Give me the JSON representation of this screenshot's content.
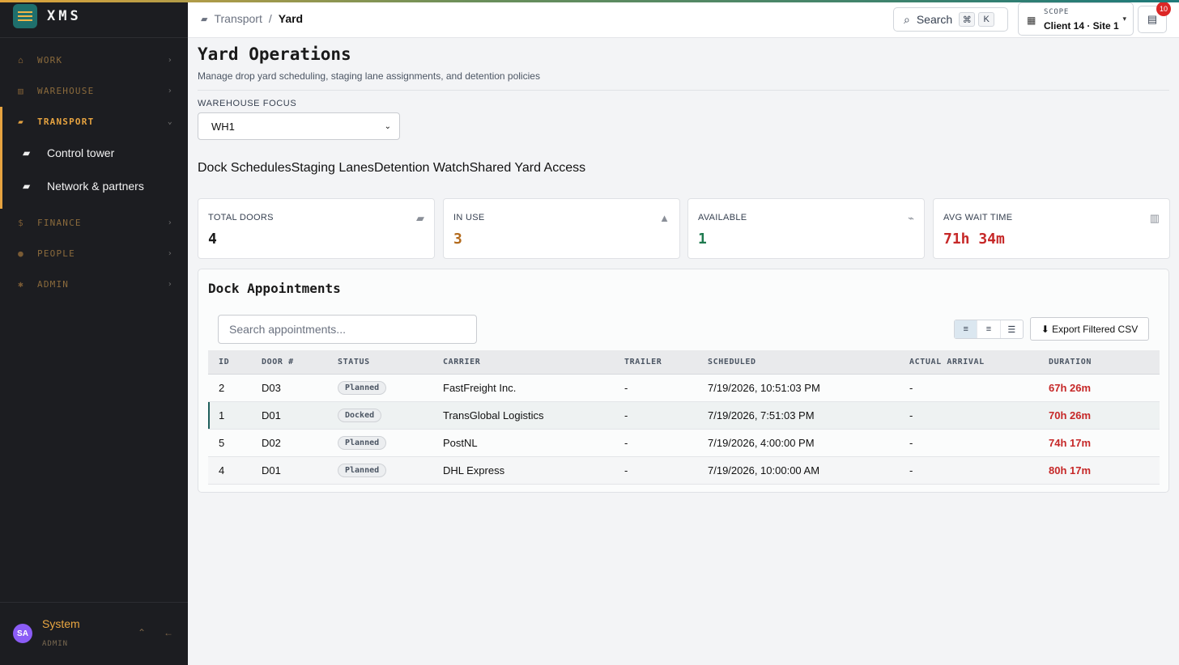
{
  "app": {
    "name": "XMS"
  },
  "colors": {
    "accent": "#e6a340",
    "teal": "#1f6f6c",
    "danger": "#c62828",
    "success": "#1e7a4f",
    "warning": "#b36b1e"
  },
  "sidebar": {
    "items": [
      {
        "label": "WORK",
        "icon": "home-icon"
      },
      {
        "label": "WAREHOUSE",
        "icon": "warehouse-icon"
      },
      {
        "label": "TRANSPORT",
        "icon": "truck-icon",
        "active": true
      },
      {
        "label": "FINANCE",
        "icon": "dollar-icon"
      },
      {
        "label": "PEOPLE",
        "icon": "person-icon"
      },
      {
        "label": "ADMIN",
        "icon": "gear-icon"
      }
    ],
    "sub_items": [
      {
        "label": "Control tower",
        "icon": "truck-icon"
      },
      {
        "label": "Network & partners",
        "icon": "truck-icon"
      }
    ],
    "user": {
      "initials": "SA",
      "name": "System",
      "role": "ADMIN"
    }
  },
  "header": {
    "breadcrumb": {
      "parent": "Transport",
      "sep": "/",
      "current": "Yard"
    },
    "search_label": "Search",
    "kbd_cmd": "⌘",
    "kbd_key": "K",
    "scope_label": "SCOPE",
    "scope_value": "Client 14 · Site 1",
    "notif_count": "10"
  },
  "page": {
    "title": "Yard Operations",
    "subtitle": "Manage drop yard scheduling, staging lane assignments, and detention policies",
    "warehouse_label": "WAREHOUSE FOCUS",
    "warehouse_value": "WH1",
    "tabs": [
      "Dock Schedules",
      "Staging Lanes",
      "Detention Watch",
      "Shared Yard Access"
    ]
  },
  "stats": [
    {
      "label": "TOTAL DOORS",
      "value": "4",
      "icon": "truck-icon",
      "color": "#1a1a1a"
    },
    {
      "label": "IN USE",
      "value": "3",
      "icon": "warning-icon",
      "color": "#b36b1e"
    },
    {
      "label": "AVAILABLE",
      "value": "1",
      "icon": "activity-icon",
      "color": "#1e7a4f"
    },
    {
      "label": "AVG WAIT TIME",
      "value": "71h 34m",
      "icon": "chart-icon",
      "color": "#c62828"
    }
  ],
  "appointments": {
    "title": "Dock Appointments",
    "search_placeholder": "Search appointments...",
    "export_label": "⬇ Export Filtered CSV",
    "columns": [
      "ID",
      "DOOR #",
      "STATUS",
      "CARRIER",
      "TRAILER",
      "SCHEDULED",
      "ACTUAL ARRIVAL",
      "DURATION"
    ],
    "rows": [
      {
        "id": "2",
        "door": "D03",
        "status": "Planned",
        "carrier": "FastFreight Inc.",
        "trailer": "-",
        "scheduled": "7/19/2026, 10:51:03 PM",
        "arrival": "-",
        "duration": "67h 26m"
      },
      {
        "id": "1",
        "door": "D01",
        "status": "Docked",
        "carrier": "TransGlobal Logistics",
        "trailer": "-",
        "scheduled": "7/19/2026, 7:51:03 PM",
        "arrival": "-",
        "duration": "70h 26m"
      },
      {
        "id": "5",
        "door": "D02",
        "status": "Planned",
        "carrier": "PostNL",
        "trailer": "-",
        "scheduled": "7/19/2026, 4:00:00 PM",
        "arrival": "-",
        "duration": "74h 17m"
      },
      {
        "id": "4",
        "door": "D01",
        "status": "Planned",
        "carrier": "DHL Express",
        "trailer": "-",
        "scheduled": "7/19/2026, 10:00:00 AM",
        "arrival": "-",
        "duration": "80h 17m"
      }
    ]
  }
}
